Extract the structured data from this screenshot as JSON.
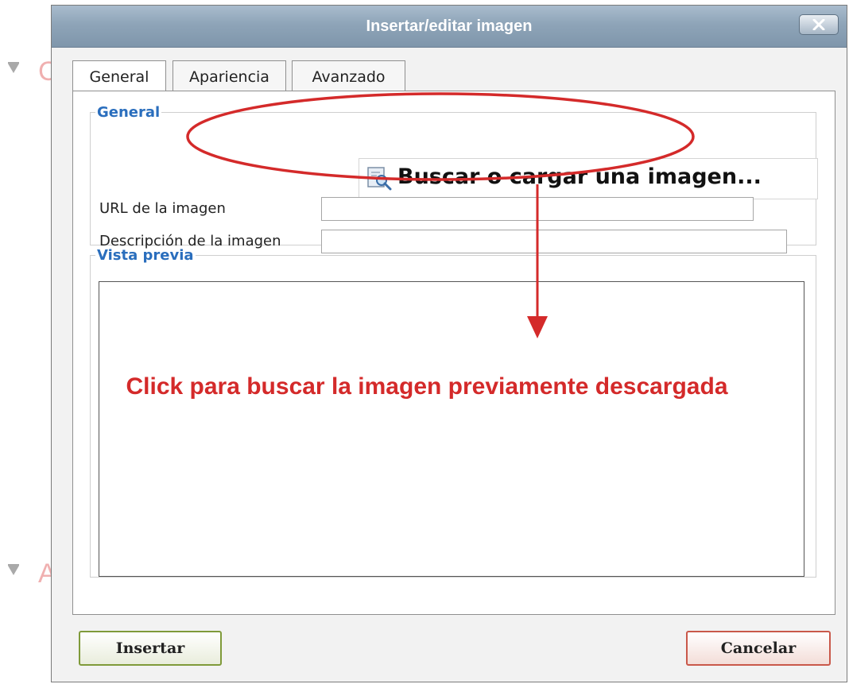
{
  "background": {
    "section_letters": [
      "C",
      "A"
    ]
  },
  "dialog": {
    "title": "Insertar/editar imagen",
    "close_icon": "close-x-icon",
    "tabs": [
      {
        "label": "General",
        "active": true
      },
      {
        "label": "Apariencia",
        "active": false
      },
      {
        "label": "Avanzado",
        "active": false
      }
    ],
    "general": {
      "legend": "General",
      "browse_label": "Buscar o cargar una imagen...",
      "browse_icon": "image-search-icon",
      "url_label": "URL de la imagen",
      "url_value": "",
      "description_label": "Descripción de la imagen",
      "description_value": ""
    },
    "preview": {
      "legend": "Vista previa"
    },
    "buttons": {
      "insert": "Insertar",
      "cancel": "Cancelar"
    }
  },
  "annotation": {
    "text": "Click para buscar la imagen previamente descargada",
    "color": "#d42a2a"
  }
}
